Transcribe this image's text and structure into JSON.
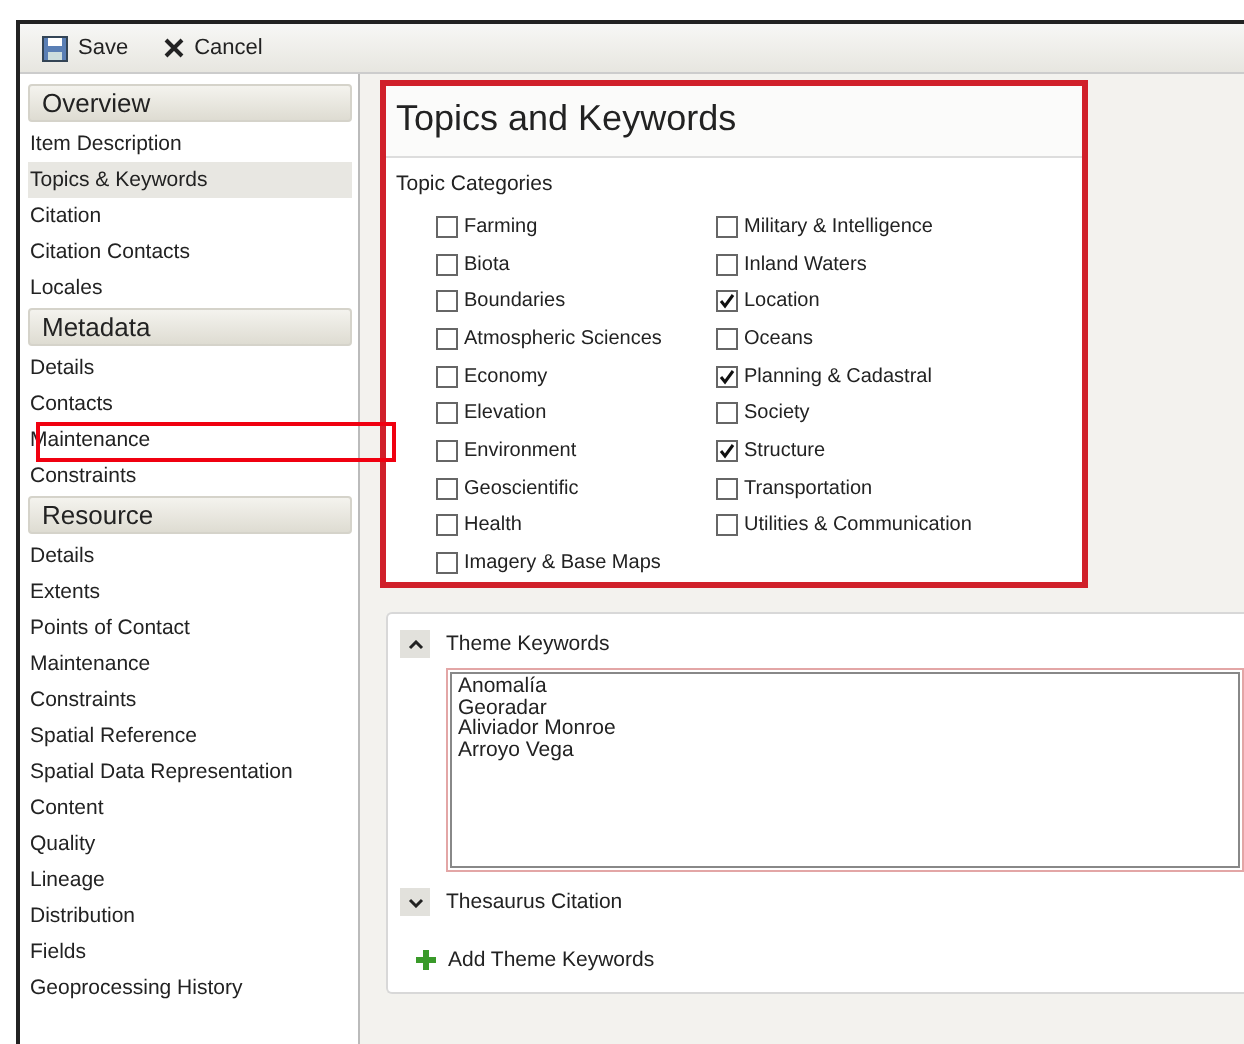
{
  "toolbar": {
    "buttons": [
      {
        "kind": "save",
        "label": "Save"
      },
      {
        "kind": "cancel",
        "label": "Cancel"
      }
    ]
  },
  "sidebar": {
    "sections": [
      {
        "title": "Overview",
        "items": [
          {
            "label": "Item Description",
            "selected": false
          },
          {
            "label": "Topics & Keywords",
            "selected": true
          },
          {
            "label": "Citation",
            "selected": false
          },
          {
            "label": "Citation Contacts",
            "selected": false
          },
          {
            "label": "Locales",
            "selected": false
          }
        ]
      },
      {
        "title": "Metadata",
        "items": [
          {
            "label": "Details",
            "selected": false
          },
          {
            "label": "Contacts",
            "selected": false
          },
          {
            "label": "Maintenance",
            "selected": false
          },
          {
            "label": "Constraints",
            "selected": false
          }
        ]
      },
      {
        "title": "Resource",
        "items": [
          {
            "label": "Details",
            "selected": false
          },
          {
            "label": "Extents",
            "selected": false
          },
          {
            "label": "Points of Contact",
            "selected": false
          },
          {
            "label": "Maintenance",
            "selected": false
          },
          {
            "label": "Constraints",
            "selected": false
          },
          {
            "label": "Spatial Reference",
            "selected": false
          },
          {
            "label": "Spatial Data Representation",
            "selected": false
          },
          {
            "label": "Content",
            "selected": false
          },
          {
            "label": "Quality",
            "selected": false
          },
          {
            "label": "Lineage",
            "selected": false
          },
          {
            "label": "Distribution",
            "selected": false
          },
          {
            "label": "Fields",
            "selected": false
          },
          {
            "label": "Geoprocessing History",
            "selected": false
          }
        ]
      }
    ]
  },
  "topics": {
    "title": "Topics and Keywords",
    "group_label": "Topic Categories",
    "items": [
      {
        "label": "Farming",
        "checked": false
      },
      {
        "label": "Biota",
        "checked": false
      },
      {
        "label": "Boundaries",
        "checked": false
      },
      {
        "label": "Atmospheric Sciences",
        "checked": false
      },
      {
        "label": "Economy",
        "checked": false
      },
      {
        "label": "Elevation",
        "checked": false
      },
      {
        "label": "Environment",
        "checked": false
      },
      {
        "label": "Geoscientific",
        "checked": false
      },
      {
        "label": "Health",
        "checked": false
      },
      {
        "label": "Imagery & Base Maps",
        "checked": false
      },
      {
        "label": "Military & Intelligence",
        "checked": false
      },
      {
        "label": "Inland Waters",
        "checked": false
      },
      {
        "label": "Location",
        "checked": true
      },
      {
        "label": "Oceans",
        "checked": false
      },
      {
        "label": "Planning & Cadastral",
        "checked": true
      },
      {
        "label": "Society",
        "checked": false
      },
      {
        "label": "Structure",
        "checked": true
      },
      {
        "label": "Transportation",
        "checked": false
      },
      {
        "label": "Utilities & Communication",
        "checked": false
      }
    ]
  },
  "theme_keywords": {
    "sections": [
      {
        "label": "Theme Keywords",
        "expanded": true,
        "value": "Anomalía\nGeoradar\nAliviador Monroe\nArroyo Vega"
      },
      {
        "label": "Thesaurus Citation",
        "expanded": false
      }
    ],
    "add_button": "Add Theme Keywords"
  }
}
